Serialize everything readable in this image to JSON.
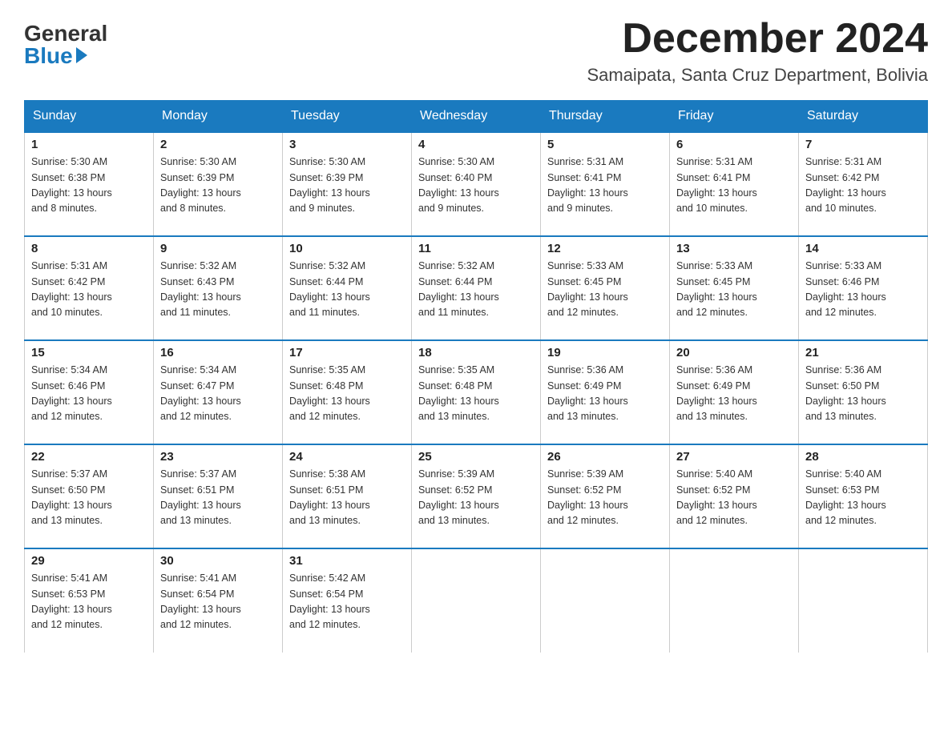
{
  "logo": {
    "general": "General",
    "blue": "Blue"
  },
  "title": "December 2024",
  "location": "Samaipata, Santa Cruz Department, Bolivia",
  "days_of_week": [
    "Sunday",
    "Monday",
    "Tuesday",
    "Wednesday",
    "Thursday",
    "Friday",
    "Saturday"
  ],
  "weeks": [
    [
      {
        "day": "1",
        "sunrise": "5:30 AM",
        "sunset": "6:38 PM",
        "daylight": "13 hours and 8 minutes."
      },
      {
        "day": "2",
        "sunrise": "5:30 AM",
        "sunset": "6:39 PM",
        "daylight": "13 hours and 8 minutes."
      },
      {
        "day": "3",
        "sunrise": "5:30 AM",
        "sunset": "6:39 PM",
        "daylight": "13 hours and 9 minutes."
      },
      {
        "day": "4",
        "sunrise": "5:30 AM",
        "sunset": "6:40 PM",
        "daylight": "13 hours and 9 minutes."
      },
      {
        "day": "5",
        "sunrise": "5:31 AM",
        "sunset": "6:41 PM",
        "daylight": "13 hours and 9 minutes."
      },
      {
        "day": "6",
        "sunrise": "5:31 AM",
        "sunset": "6:41 PM",
        "daylight": "13 hours and 10 minutes."
      },
      {
        "day": "7",
        "sunrise": "5:31 AM",
        "sunset": "6:42 PM",
        "daylight": "13 hours and 10 minutes."
      }
    ],
    [
      {
        "day": "8",
        "sunrise": "5:31 AM",
        "sunset": "6:42 PM",
        "daylight": "13 hours and 10 minutes."
      },
      {
        "day": "9",
        "sunrise": "5:32 AM",
        "sunset": "6:43 PM",
        "daylight": "13 hours and 11 minutes."
      },
      {
        "day": "10",
        "sunrise": "5:32 AM",
        "sunset": "6:44 PM",
        "daylight": "13 hours and 11 minutes."
      },
      {
        "day": "11",
        "sunrise": "5:32 AM",
        "sunset": "6:44 PM",
        "daylight": "13 hours and 11 minutes."
      },
      {
        "day": "12",
        "sunrise": "5:33 AM",
        "sunset": "6:45 PM",
        "daylight": "13 hours and 12 minutes."
      },
      {
        "day": "13",
        "sunrise": "5:33 AM",
        "sunset": "6:45 PM",
        "daylight": "13 hours and 12 minutes."
      },
      {
        "day": "14",
        "sunrise": "5:33 AM",
        "sunset": "6:46 PM",
        "daylight": "13 hours and 12 minutes."
      }
    ],
    [
      {
        "day": "15",
        "sunrise": "5:34 AM",
        "sunset": "6:46 PM",
        "daylight": "13 hours and 12 minutes."
      },
      {
        "day": "16",
        "sunrise": "5:34 AM",
        "sunset": "6:47 PM",
        "daylight": "13 hours and 12 minutes."
      },
      {
        "day": "17",
        "sunrise": "5:35 AM",
        "sunset": "6:48 PM",
        "daylight": "13 hours and 12 minutes."
      },
      {
        "day": "18",
        "sunrise": "5:35 AM",
        "sunset": "6:48 PM",
        "daylight": "13 hours and 13 minutes."
      },
      {
        "day": "19",
        "sunrise": "5:36 AM",
        "sunset": "6:49 PM",
        "daylight": "13 hours and 13 minutes."
      },
      {
        "day": "20",
        "sunrise": "5:36 AM",
        "sunset": "6:49 PM",
        "daylight": "13 hours and 13 minutes."
      },
      {
        "day": "21",
        "sunrise": "5:36 AM",
        "sunset": "6:50 PM",
        "daylight": "13 hours and 13 minutes."
      }
    ],
    [
      {
        "day": "22",
        "sunrise": "5:37 AM",
        "sunset": "6:50 PM",
        "daylight": "13 hours and 13 minutes."
      },
      {
        "day": "23",
        "sunrise": "5:37 AM",
        "sunset": "6:51 PM",
        "daylight": "13 hours and 13 minutes."
      },
      {
        "day": "24",
        "sunrise": "5:38 AM",
        "sunset": "6:51 PM",
        "daylight": "13 hours and 13 minutes."
      },
      {
        "day": "25",
        "sunrise": "5:39 AM",
        "sunset": "6:52 PM",
        "daylight": "13 hours and 13 minutes."
      },
      {
        "day": "26",
        "sunrise": "5:39 AM",
        "sunset": "6:52 PM",
        "daylight": "13 hours and 12 minutes."
      },
      {
        "day": "27",
        "sunrise": "5:40 AM",
        "sunset": "6:52 PM",
        "daylight": "13 hours and 12 minutes."
      },
      {
        "day": "28",
        "sunrise": "5:40 AM",
        "sunset": "6:53 PM",
        "daylight": "13 hours and 12 minutes."
      }
    ],
    [
      {
        "day": "29",
        "sunrise": "5:41 AM",
        "sunset": "6:53 PM",
        "daylight": "13 hours and 12 minutes."
      },
      {
        "day": "30",
        "sunrise": "5:41 AM",
        "sunset": "6:54 PM",
        "daylight": "13 hours and 12 minutes."
      },
      {
        "day": "31",
        "sunrise": "5:42 AM",
        "sunset": "6:54 PM",
        "daylight": "13 hours and 12 minutes."
      },
      null,
      null,
      null,
      null
    ]
  ],
  "labels": {
    "sunrise": "Sunrise:",
    "sunset": "Sunset:",
    "daylight": "Daylight:"
  }
}
